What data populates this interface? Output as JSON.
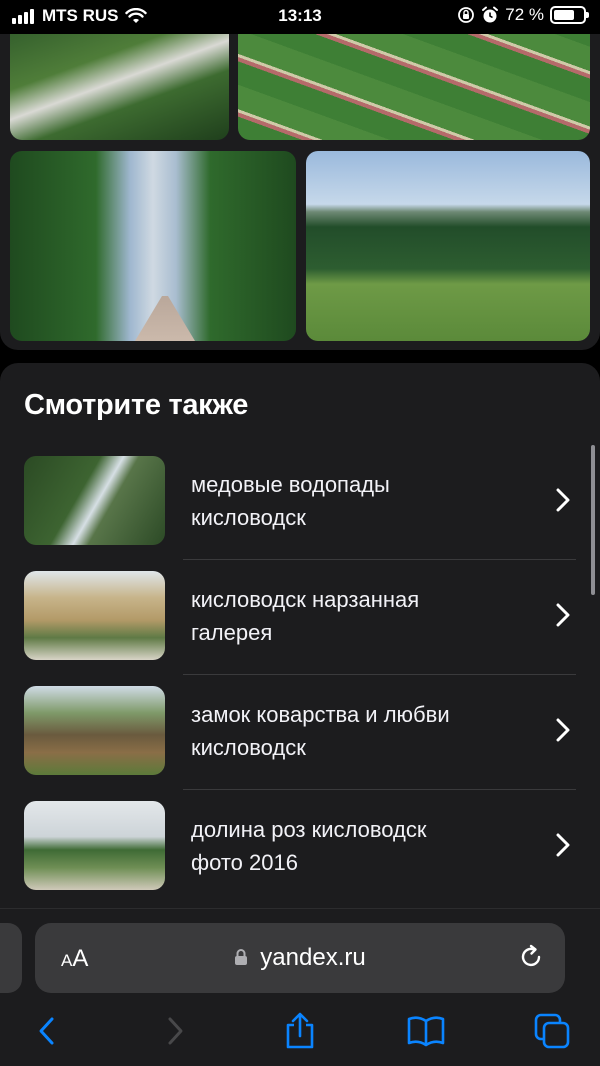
{
  "status_bar": {
    "carrier": "MTS RUS",
    "time": "13:13",
    "battery": "72 %",
    "battery_level": 0.72
  },
  "gallery": {
    "images": [
      "garden-path-hedges",
      "rose-valley-beds",
      "cypress-alley",
      "rose-valley-panorama"
    ]
  },
  "see_also": {
    "title": "Смотрите также",
    "items": [
      {
        "line1": "медовые водопады",
        "line2": "кисловодск",
        "thumb": "waterfall"
      },
      {
        "line1": "кисловодск нарзанная",
        "line2": "галерея",
        "thumb": "narzan-gallery"
      },
      {
        "line1": "замок коварства и любви",
        "line2": "кисловодск",
        "thumb": "castle"
      },
      {
        "line1": "долина роз кисловодск",
        "line2": "фото 2016",
        "thumb": "rose-valley"
      }
    ]
  },
  "browser": {
    "text_size_label": "AA",
    "url": "yandex.ru",
    "accent": "#0a84ff"
  }
}
